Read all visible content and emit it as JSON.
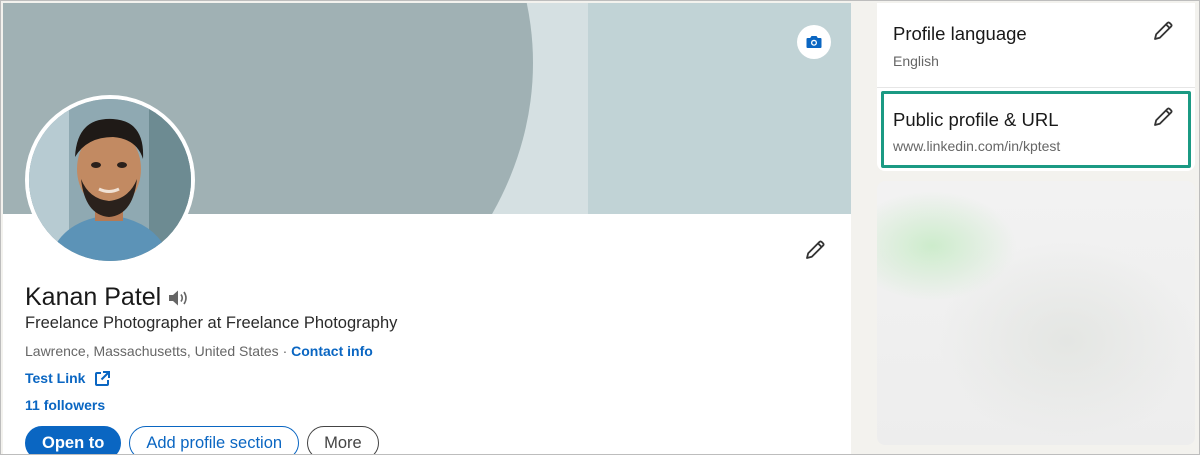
{
  "profile": {
    "name": "Kanan Patel",
    "headline": "Freelance Photographer at Freelance Photography",
    "location": "Lawrence, Massachusetts, United States",
    "separator": " · ",
    "contact_info_label": "Contact info",
    "website_label": "Test Link",
    "followers_label": "11 followers",
    "icons": {
      "camera": "camera-icon",
      "edit": "pencil-icon",
      "pronunciation": "speaker-icon",
      "external_link": "external-link-icon"
    }
  },
  "actions": {
    "open_to_label": "Open to",
    "add_section_label": "Add profile section",
    "more_label": "More"
  },
  "sidebar": {
    "profile_language": {
      "title": "Profile language",
      "value": "English"
    },
    "public_profile": {
      "title": "Public profile & URL",
      "url": "www.linkedin.com/in/kptest"
    }
  },
  "colors": {
    "accent": "#0a66c2",
    "highlight": "#1b9a83",
    "banner_dark": "#a0b1b4",
    "banner_light": "#c1d3d6"
  }
}
